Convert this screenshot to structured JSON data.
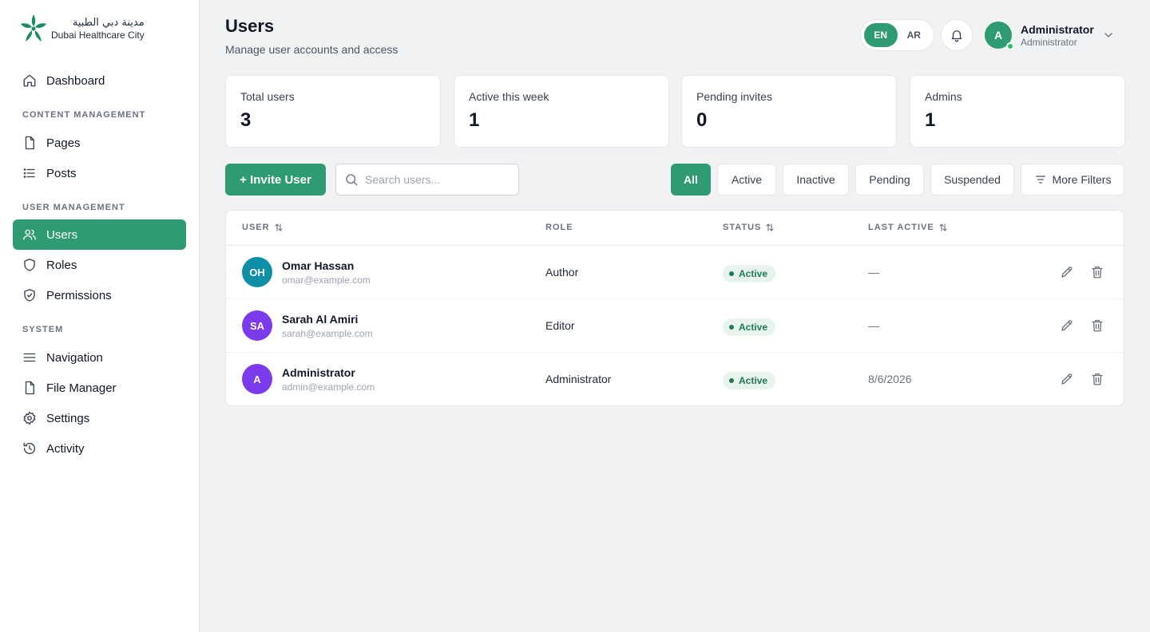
{
  "brand": {
    "arabic_name": "مدينة دبي الطبية",
    "english_name": "Dubai Healthcare City",
    "color": "#2e9b72"
  },
  "sidebar": {
    "dashboard": "Dashboard",
    "sections": {
      "content": "CONTENT MANAGEMENT",
      "users": "USER MANAGEMENT",
      "system": "SYSTEM"
    },
    "items": [
      {
        "label": "Pages",
        "icon": "file-icon"
      },
      {
        "label": "Posts",
        "icon": "list-icon"
      },
      {
        "label": "Users",
        "icon": "users-icon",
        "active": true
      },
      {
        "label": "Roles",
        "icon": "shield-icon"
      },
      {
        "label": "Permissions",
        "icon": "shield-check-icon"
      },
      {
        "label": "Navigation",
        "icon": "menu-icon"
      },
      {
        "label": "File Manager",
        "icon": "file-icon"
      },
      {
        "label": "Settings",
        "icon": "gear-icon"
      },
      {
        "label": "Activity",
        "icon": "history-icon"
      }
    ]
  },
  "header": {
    "title": "Users",
    "subtitle": "Manage user accounts and access",
    "lang": {
      "en": "EN",
      "ar": "AR",
      "selected": "EN"
    },
    "user": {
      "initial": "A",
      "name": "Administrator",
      "role": "Administrator"
    }
  },
  "stats": [
    {
      "label": "Total users",
      "value": "3"
    },
    {
      "label": "Active this week",
      "value": "1"
    },
    {
      "label": "Pending invites",
      "value": "0"
    },
    {
      "label": "Admins",
      "value": "1"
    }
  ],
  "toolbar": {
    "invite_label": "+ Invite User",
    "search_placeholder": "Search users...",
    "filters": [
      "All",
      "Active",
      "Inactive",
      "Pending",
      "Suspended"
    ],
    "selected_filter": "All",
    "more_filters": "More Filters"
  },
  "table": {
    "columns": {
      "user": "USER",
      "role": "ROLE",
      "status": "STATUS",
      "last_active": "LAST ACTIVE"
    },
    "rows": [
      {
        "initials": "OH",
        "avatar_color": "#0e8fa8",
        "name": "Omar Hassan",
        "email": "omar@example.com",
        "role": "Author",
        "status": "Active",
        "last_active": "—"
      },
      {
        "initials": "SA",
        "avatar_color": "#7c3aed",
        "name": "Sarah Al Amiri",
        "email": "sarah@example.com",
        "role": "Editor",
        "status": "Active",
        "last_active": "—"
      },
      {
        "initials": "A",
        "avatar_color": "#7c3aed",
        "name": "Administrator",
        "email": "admin@example.com",
        "role": "Administrator",
        "status": "Active",
        "last_active": "8/6/2026"
      }
    ]
  }
}
